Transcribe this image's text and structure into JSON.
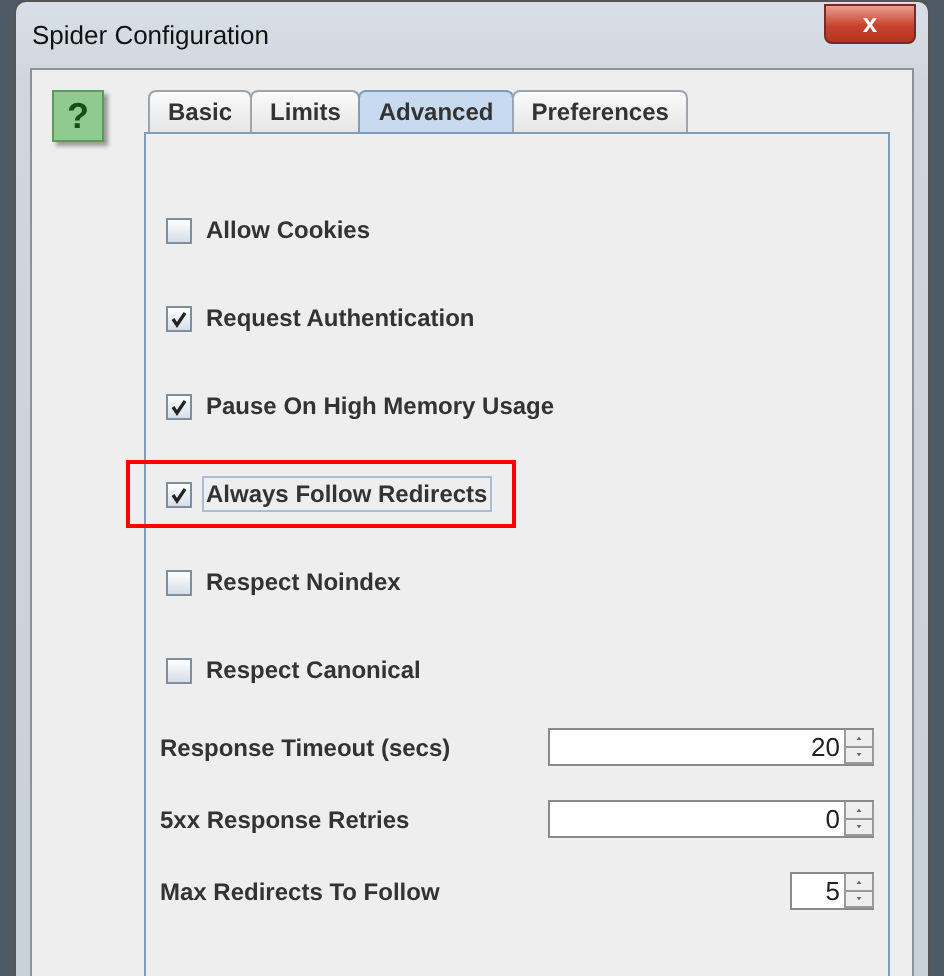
{
  "window": {
    "title": "Spider Configuration",
    "close_label": "x"
  },
  "help_icon": "?",
  "tabs": [
    {
      "label": "Basic",
      "selected": false
    },
    {
      "label": "Limits",
      "selected": false
    },
    {
      "label": "Advanced",
      "selected": true
    },
    {
      "label": "Preferences",
      "selected": false
    }
  ],
  "options": [
    {
      "label": "Allow Cookies",
      "checked": false,
      "focused": false,
      "highlighted": false
    },
    {
      "label": "Request Authentication",
      "checked": true,
      "focused": false,
      "highlighted": false
    },
    {
      "label": "Pause On High Memory Usage",
      "checked": true,
      "focused": false,
      "highlighted": false
    },
    {
      "label": "Always Follow Redirects",
      "checked": true,
      "focused": true,
      "highlighted": true
    },
    {
      "label": "Respect Noindex",
      "checked": false,
      "focused": false,
      "highlighted": false
    },
    {
      "label": "Respect Canonical",
      "checked": false,
      "focused": false,
      "highlighted": false
    }
  ],
  "spinners": [
    {
      "label": "Response Timeout (secs)",
      "value": "20",
      "kind": "wide"
    },
    {
      "label": "5xx Response Retries",
      "value": "0",
      "kind": "wide"
    },
    {
      "label": "Max Redirects To Follow",
      "value": "5",
      "kind": "narrow"
    }
  ]
}
